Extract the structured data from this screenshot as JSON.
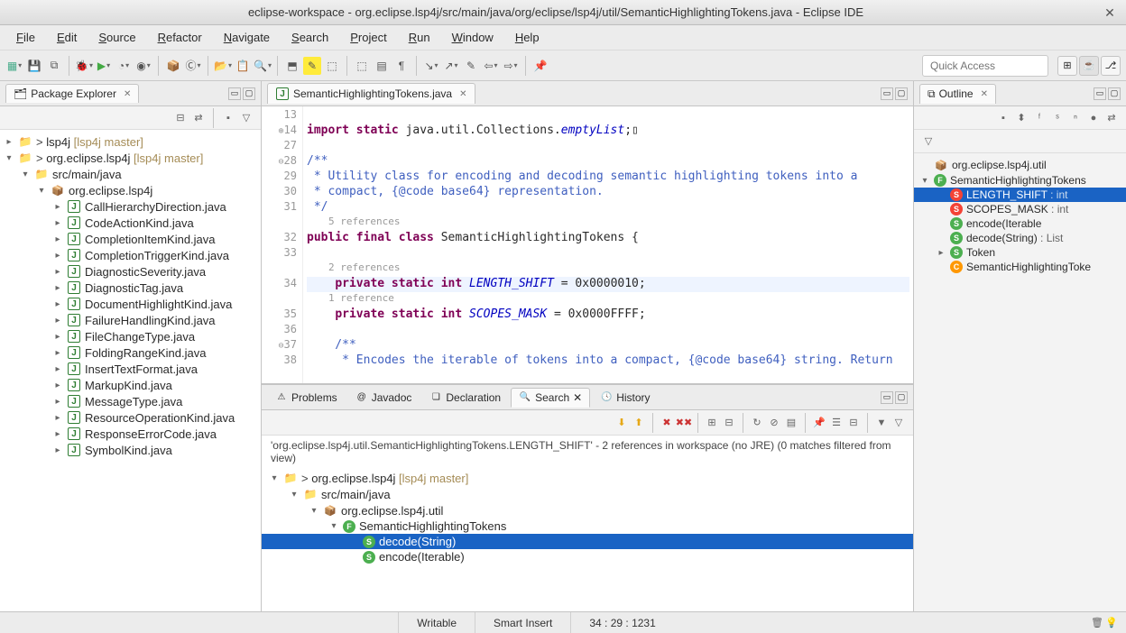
{
  "window": {
    "title": "eclipse-workspace - org.eclipse.lsp4j/src/main/java/org/eclipse/lsp4j/util/SemanticHighlightingTokens.java - Eclipse IDE"
  },
  "menus": [
    "File",
    "Edit",
    "Source",
    "Refactor",
    "Navigate",
    "Search",
    "Project",
    "Run",
    "Window",
    "Help"
  ],
  "quick_access_placeholder": "Quick Access",
  "package_explorer": {
    "title": "Package Explorer",
    "items": [
      {
        "depth": 0,
        "twisty": "▸",
        "icon": "proj",
        "dirty": true,
        "label": "lsp4j",
        "repo": "[lsp4j master]"
      },
      {
        "depth": 0,
        "twisty": "▾",
        "icon": "proj",
        "dirty": true,
        "label": "org.eclipse.lsp4j",
        "repo": "[lsp4j master]"
      },
      {
        "depth": 1,
        "twisty": "▾",
        "icon": "folder",
        "label": "src/main/java"
      },
      {
        "depth": 2,
        "twisty": "▾",
        "icon": "pkg",
        "label": "org.eclipse.lsp4j"
      },
      {
        "depth": 3,
        "twisty": "▸",
        "icon": "java",
        "label": "CallHierarchyDirection.java"
      },
      {
        "depth": 3,
        "twisty": "▸",
        "icon": "java",
        "label": "CodeActionKind.java"
      },
      {
        "depth": 3,
        "twisty": "▸",
        "icon": "java",
        "label": "CompletionItemKind.java"
      },
      {
        "depth": 3,
        "twisty": "▸",
        "icon": "java",
        "label": "CompletionTriggerKind.java"
      },
      {
        "depth": 3,
        "twisty": "▸",
        "icon": "java",
        "label": "DiagnosticSeverity.java"
      },
      {
        "depth": 3,
        "twisty": "▸",
        "icon": "java",
        "label": "DiagnosticTag.java"
      },
      {
        "depth": 3,
        "twisty": "▸",
        "icon": "java",
        "label": "DocumentHighlightKind.java"
      },
      {
        "depth": 3,
        "twisty": "▸",
        "icon": "java",
        "label": "FailureHandlingKind.java"
      },
      {
        "depth": 3,
        "twisty": "▸",
        "icon": "java",
        "label": "FileChangeType.java"
      },
      {
        "depth": 3,
        "twisty": "▸",
        "icon": "java",
        "label": "FoldingRangeKind.java"
      },
      {
        "depth": 3,
        "twisty": "▸",
        "icon": "java",
        "label": "InsertTextFormat.java"
      },
      {
        "depth": 3,
        "twisty": "▸",
        "icon": "java",
        "label": "MarkupKind.java"
      },
      {
        "depth": 3,
        "twisty": "▸",
        "icon": "java",
        "label": "MessageType.java"
      },
      {
        "depth": 3,
        "twisty": "▸",
        "icon": "java",
        "label": "ResourceOperationKind.java"
      },
      {
        "depth": 3,
        "twisty": "▸",
        "icon": "java",
        "label": "ResponseErrorCode.java"
      },
      {
        "depth": 3,
        "twisty": "▸",
        "icon": "java",
        "label": "SymbolKind.java"
      }
    ]
  },
  "editor": {
    "tab_title": "SemanticHighlightingTokens.java",
    "lines": [
      {
        "n": "13",
        "t": ""
      },
      {
        "n": "14",
        "fold": "⊕",
        "t": "import static java.util.Collections.emptyList;▯",
        "kind": "import"
      },
      {
        "n": "27",
        "t": ""
      },
      {
        "n": "28",
        "fold": "⊖",
        "t": "/**",
        "kind": "jdoc"
      },
      {
        "n": "29",
        "t": " * Utility class for encoding and decoding semantic highlighting tokens into a",
        "kind": "jdoc"
      },
      {
        "n": "30",
        "t": " * compact, {@code base64} representation.",
        "kind": "jdoc"
      },
      {
        "n": "31",
        "t": " */",
        "kind": "jdoc"
      },
      {
        "refs": "5 references"
      },
      {
        "n": "32",
        "t": "public final class SemanticHighlightingTokens {",
        "kind": "decl"
      },
      {
        "n": "33",
        "t": ""
      },
      {
        "refs": "2 references"
      },
      {
        "n": "34",
        "hl": true,
        "t": "    private static int LENGTH_SHIFT = 0x0000010;",
        "kind": "field",
        "field": "LENGTH_SHIFT"
      },
      {
        "refs": "1 reference"
      },
      {
        "n": "35",
        "t": "    private static int SCOPES_MASK = 0x0000FFFF;",
        "kind": "field",
        "field": "SCOPES_MASK"
      },
      {
        "n": "36",
        "t": ""
      },
      {
        "n": "37",
        "fold": "⊖",
        "t": "    /**",
        "kind": "jdoc"
      },
      {
        "n": "38",
        "t": "     * Encodes the iterable of tokens into a compact, {@code base64} string. Return",
        "kind": "jdoc"
      }
    ]
  },
  "outline": {
    "title": "Outline",
    "items": [
      {
        "depth": 0,
        "twisty": "",
        "icon": "pkg",
        "label": "org.eclipse.lsp4j.util"
      },
      {
        "depth": 0,
        "twisty": "▾",
        "icon": "class-pub",
        "badge": "F",
        "label": "SemanticHighlightingTokens"
      },
      {
        "depth": 1,
        "twisty": "",
        "icon": "field-priv",
        "badge": "S",
        "label": "LENGTH_SHIFT",
        "decl": ": int",
        "selected": true
      },
      {
        "depth": 1,
        "twisty": "",
        "icon": "field-priv",
        "badge": "S",
        "label": "SCOPES_MASK",
        "decl": ": int"
      },
      {
        "depth": 1,
        "twisty": "",
        "icon": "method-pub",
        "badge": "S",
        "label": "encode(Iterable<? extends"
      },
      {
        "depth": 1,
        "twisty": "",
        "icon": "method-pub",
        "badge": "S",
        "label": "decode(String)",
        "decl": ": List<Toker"
      },
      {
        "depth": 1,
        "twisty": "▸",
        "icon": "class-pub",
        "badge": "S",
        "label": "Token"
      },
      {
        "depth": 1,
        "twisty": "",
        "icon": "class-inner",
        "badge": "C",
        "label": "SemanticHighlightingToke"
      }
    ]
  },
  "bottom": {
    "tabs": [
      "Problems",
      "Javadoc",
      "Declaration",
      "Search",
      "History"
    ],
    "active_tab": "Search",
    "search_desc": "'org.eclipse.lsp4j.util.SemanticHighlightingTokens.LENGTH_SHIFT' - 2 references in workspace (no JRE) (0 matches filtered from view)",
    "tree": [
      {
        "depth": 0,
        "twisty": "▾",
        "icon": "proj",
        "dirty": true,
        "label": "org.eclipse.lsp4j",
        "repo": "[lsp4j master]"
      },
      {
        "depth": 1,
        "twisty": "▾",
        "icon": "folder",
        "label": "src/main/java"
      },
      {
        "depth": 2,
        "twisty": "▾",
        "icon": "pkg",
        "label": "org.eclipse.lsp4j.util"
      },
      {
        "depth": 3,
        "twisty": "▾",
        "icon": "class-pub",
        "badge": "F",
        "label": "SemanticHighlightingTokens"
      },
      {
        "depth": 4,
        "twisty": "",
        "icon": "method-pub",
        "badge": "S",
        "label": "decode(String)",
        "selected": true
      },
      {
        "depth": 4,
        "twisty": "",
        "icon": "method-pub",
        "badge": "S",
        "label": "encode(Iterable<? extends Token>)"
      }
    ]
  },
  "status": {
    "writable": "Writable",
    "insert": "Smart Insert",
    "position": "34 : 29 : 1231"
  }
}
